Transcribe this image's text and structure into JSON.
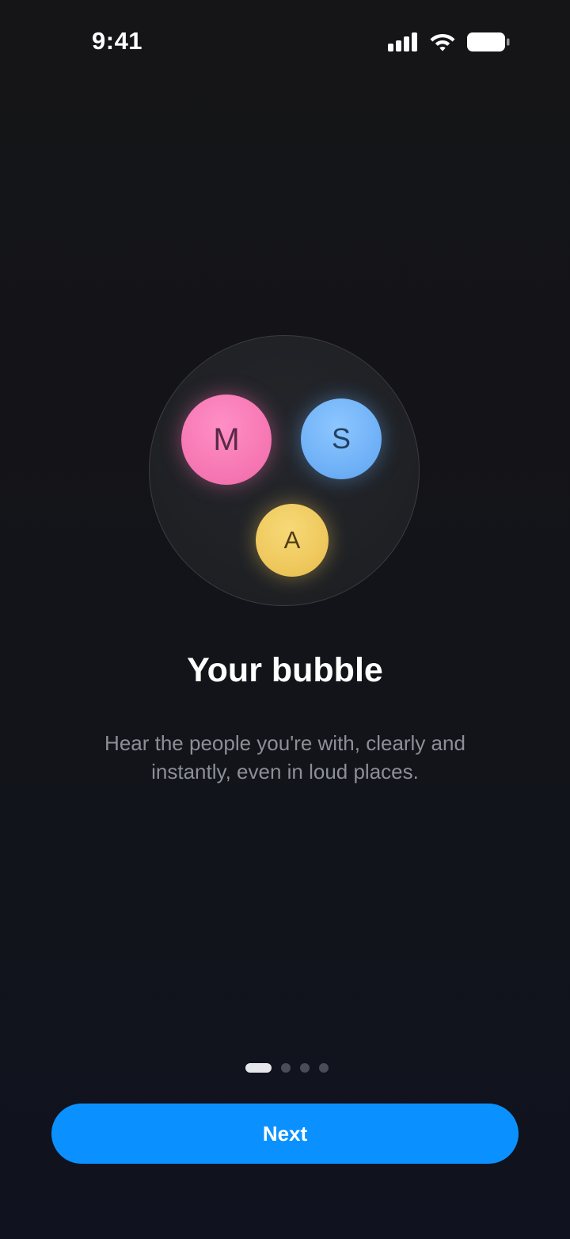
{
  "status_bar": {
    "time": "9:41",
    "icons": [
      "signal-icon",
      "wifi-icon",
      "battery-icon"
    ]
  },
  "illustration": {
    "avatars": [
      {
        "initial": "M",
        "color": "#f77ab5"
      },
      {
        "initial": "S",
        "color": "#71b2f7"
      },
      {
        "initial": "A",
        "color": "#efc95e"
      }
    ]
  },
  "onboarding": {
    "title": "Your bubble",
    "description": "Hear the people you're with, clearly and instantly, even in loud places."
  },
  "pager": {
    "total": 4,
    "current": 1
  },
  "actions": {
    "next_label": "Next"
  },
  "colors": {
    "accent": "#0a91ff",
    "background": "#131419",
    "text_secondary": "#8c8f97"
  }
}
